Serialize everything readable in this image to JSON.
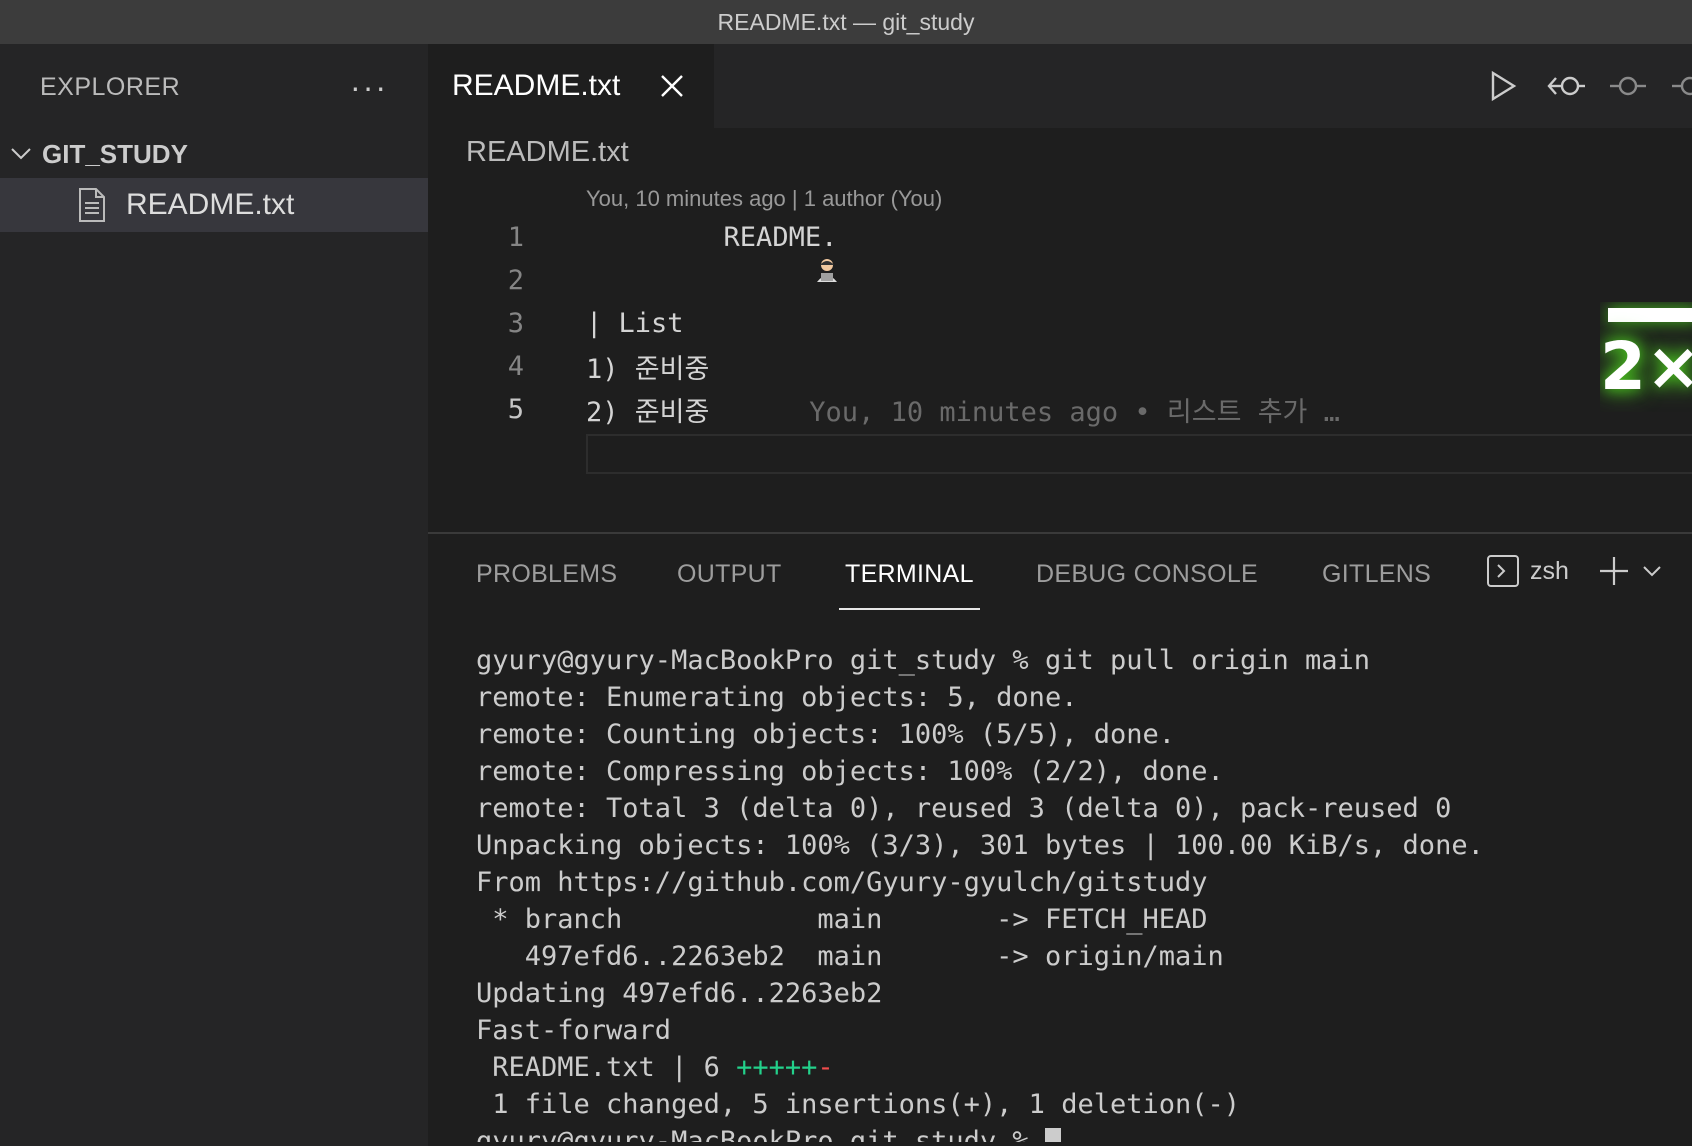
{
  "window": {
    "title": "README.txt — git_study"
  },
  "sidebar": {
    "title": "EXPLORER",
    "more_label": "···",
    "folder_name": "GIT_STUDY",
    "files": [
      {
        "name": "README.txt"
      }
    ]
  },
  "editor": {
    "tab_label": "README.txt",
    "breadcrumb": "README.txt",
    "codelens": "You, 10 minutes ago | 1 author (You)",
    "lines": [
      {
        "no": "1",
        "text": "README."
      },
      {
        "no": "2",
        "text": ""
      },
      {
        "no": "3",
        "text": "| List"
      },
      {
        "no": "4",
        "text": "1) 준비중"
      },
      {
        "no": "5",
        "text": "2) 준비중"
      }
    ],
    "blame_inline": "You, 10 minutes ago • 리스트 추가 …",
    "zoom_badge": "2×"
  },
  "panel": {
    "tabs": [
      "PROBLEMS",
      "OUTPUT",
      "TERMINAL",
      "DEBUG CONSOLE",
      "GITLENS"
    ],
    "active_tab": "TERMINAL",
    "shell": "zsh"
  },
  "terminal": {
    "lines": [
      "gyury@gyury-MacBookPro git_study % git pull origin main",
      "remote: Enumerating objects: 5, done.",
      "remote: Counting objects: 100% (5/5), done.",
      "remote: Compressing objects: 100% (2/2), done.",
      "remote: Total 3 (delta 0), reused 3 (delta 0), pack-reused 0",
      "Unpacking objects: 100% (3/3), 301 bytes | 100.00 KiB/s, done.",
      "From https://github.com/Gyury-gyulch/gitstudy",
      " * branch            main       -> FETCH_HEAD",
      "   497efd6..2263eb2  main       -> origin/main",
      "Updating 497efd6..2263eb2",
      "Fast-forward"
    ],
    "diffstat_prefix": " README.txt | 6 ",
    "diffstat_plus": "+++++",
    "diffstat_minus": "-",
    "summary": " 1 file changed, 5 insertions(+), 1 deletion(-)",
    "prompt": "gyury@gyury-MacBookPro git_study % "
  },
  "colors": {
    "accent_green": "#23d18b",
    "accent_red": "#f14c4c",
    "badge_glow": "#49c21f"
  }
}
